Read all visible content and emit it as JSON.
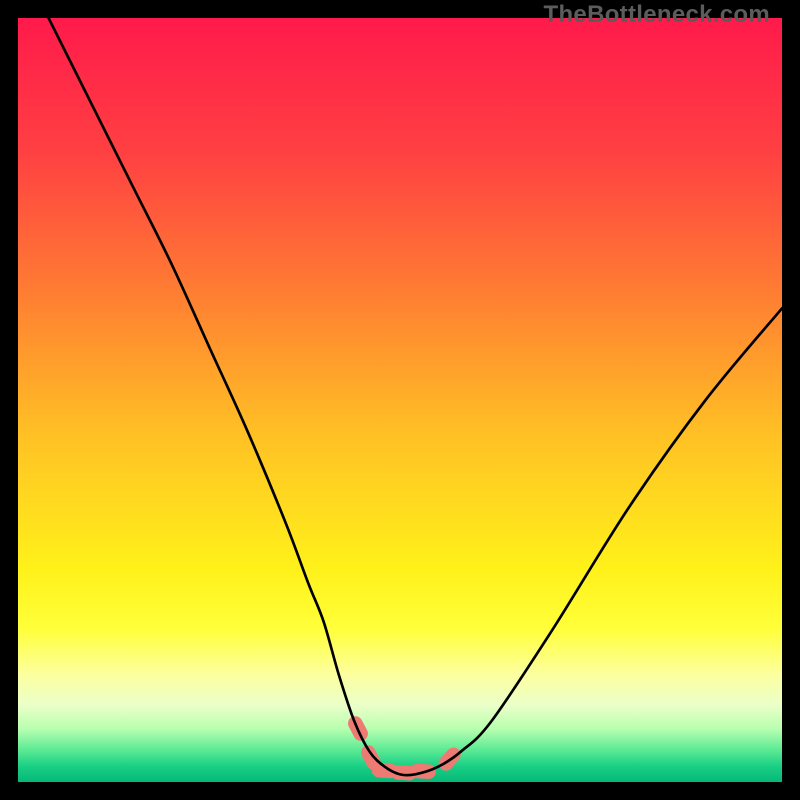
{
  "watermark": "TheBottleneck.com",
  "chart_data": {
    "type": "line",
    "title": "",
    "xlabel": "",
    "ylabel": "",
    "xlim": [
      0,
      100
    ],
    "ylim": [
      0,
      100
    ],
    "series": [
      {
        "name": "bottleneck-curve",
        "x": [
          4,
          10,
          15,
          20,
          25,
          30,
          35,
          38,
          40,
          42,
          44,
          46,
          48,
          50,
          52,
          55,
          58,
          62,
          70,
          80,
          90,
          100
        ],
        "y": [
          100,
          88,
          78,
          68,
          57,
          46,
          34,
          26,
          21,
          14,
          8,
          4,
          2,
          1,
          1,
          2,
          4,
          8,
          20,
          36,
          50,
          62
        ]
      }
    ],
    "markers": [
      {
        "name": "marker-left-upper",
        "x": 44.5,
        "y": 7.0
      },
      {
        "name": "marker-left-lower",
        "x": 46.2,
        "y": 3.2
      },
      {
        "name": "marker-bottom-1",
        "x": 48.0,
        "y": 1.5
      },
      {
        "name": "marker-bottom-2",
        "x": 50.5,
        "y": 1.2
      },
      {
        "name": "marker-bottom-3",
        "x": 53.0,
        "y": 1.4
      },
      {
        "name": "marker-right",
        "x": 56.5,
        "y": 3.0
      }
    ],
    "gradient_stops": [
      {
        "pct": 0,
        "color": "#ff1a4b"
      },
      {
        "pct": 18,
        "color": "#ff4142"
      },
      {
        "pct": 35,
        "color": "#ff7a33"
      },
      {
        "pct": 55,
        "color": "#ffc224"
      },
      {
        "pct": 72,
        "color": "#fff11a"
      },
      {
        "pct": 80,
        "color": "#ffff3a"
      },
      {
        "pct": 86,
        "color": "#fcffa0"
      },
      {
        "pct": 90,
        "color": "#eaffc8"
      },
      {
        "pct": 93,
        "color": "#b8ffb0"
      },
      {
        "pct": 96,
        "color": "#56e893"
      },
      {
        "pct": 98,
        "color": "#18cf84"
      },
      {
        "pct": 100,
        "color": "#06b877"
      }
    ],
    "marker_color": "#ed7b74",
    "curve_color": "#000000"
  }
}
